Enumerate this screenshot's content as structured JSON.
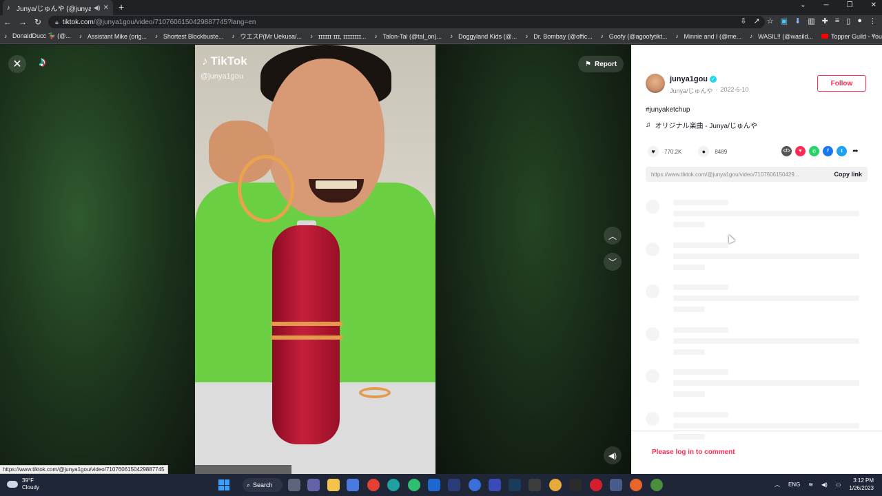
{
  "browser": {
    "tab_title": "Junya/じゅんや (@junya1gou)",
    "url_host": "tiktok.com",
    "url_path": "/@junya1gou/video/7107606150429887745?lang=en",
    "bookmarks": [
      {
        "label": "DonaldDucc 🦆 (@...",
        "icon": "tiktok"
      },
      {
        "label": "Assistant Mike (orig...",
        "icon": "tiktok"
      },
      {
        "label": "Shortest Blockbuste...",
        "icon": "tiktok"
      },
      {
        "label": "ウエスP(Mr Uekusa/...",
        "icon": "tiktok"
      },
      {
        "label": "ɪɪɪɪɪɪ ɪɪɪ, ɪɪɪɪɪɪɪɪ...",
        "icon": "tiktok"
      },
      {
        "label": "Talon-Tal (@tal_on)...",
        "icon": "tiktok"
      },
      {
        "label": "Doggyland Kids (@...",
        "icon": "tiktok"
      },
      {
        "label": "Dr. Bombay (@offic...",
        "icon": "tiktok"
      },
      {
        "label": "Goofy (@agoofytikt...",
        "icon": "tiktok"
      },
      {
        "label": "Minnie and I (@me...",
        "icon": "tiktok"
      },
      {
        "label": "WASIL!! (@wasild...",
        "icon": "tiktok"
      },
      {
        "label": "Topper Guild - YouT...",
        "icon": "youtube"
      }
    ],
    "status_url": "https://www.tiktok.com/@junya1gou/video/7107606150429887745"
  },
  "video": {
    "watermark": "TikTok",
    "handle": "@junya1gou",
    "report_label": "Report"
  },
  "post": {
    "username": "junya1gou",
    "display_name": "Junya/じゅんや",
    "date": "2022-6-10",
    "follow_label": "Follow",
    "hashtag": "#junyaketchup",
    "music": "オリジナル楽曲 - Junya/じゅんや",
    "likes": "770.2K",
    "comments": "8489",
    "link": "https://www.tiktok.com/@junya1gou/video/7107606150429...",
    "copy_link_label": "Copy link",
    "login_prompt": "Please log in to comment"
  },
  "taskbar": {
    "temperature": "39°F",
    "weather": "Cloudy",
    "search_label": "Search",
    "language": "ENG",
    "time": "3:12 PM",
    "date": "1/26/2023"
  },
  "colors": {
    "accent": "#fe2c55",
    "verified": "#20d5ec",
    "chrome_dark": "#202124"
  }
}
